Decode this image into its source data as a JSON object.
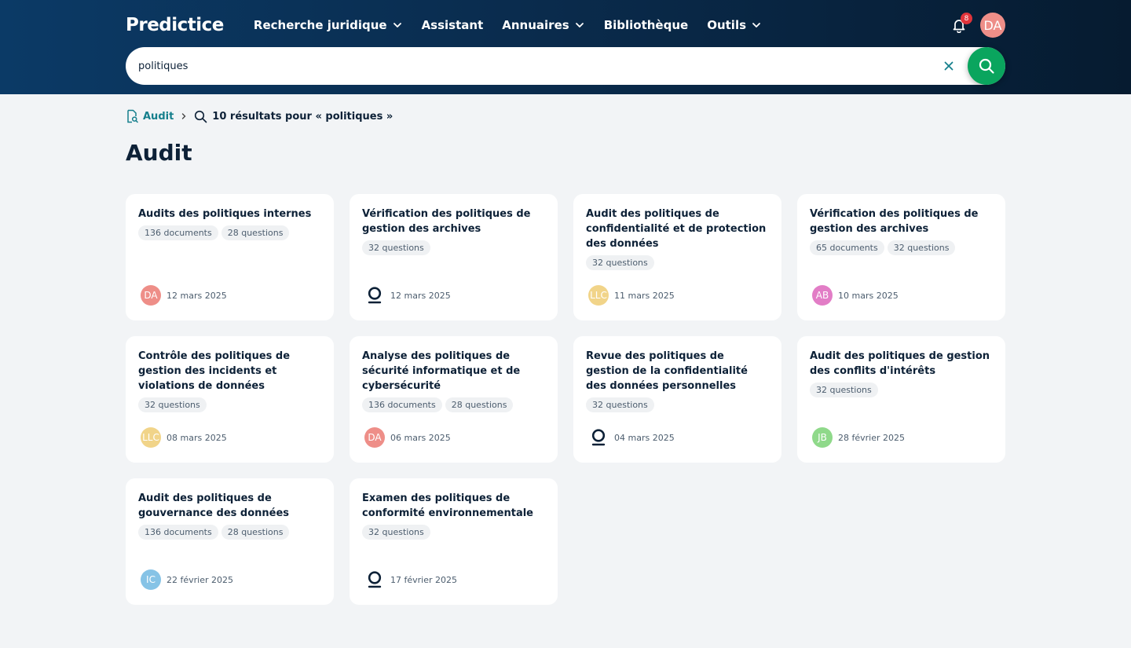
{
  "app": {
    "logo": "Predictice"
  },
  "nav": {
    "items": [
      {
        "label": "Recherche juridique",
        "dropdown": true
      },
      {
        "label": "Assistant",
        "dropdown": false
      },
      {
        "label": "Annuaires",
        "dropdown": true
      },
      {
        "label": "Bibliothèque",
        "dropdown": false
      },
      {
        "label": "Outils",
        "dropdown": true
      }
    ],
    "notifications_count": "8",
    "user_initials": "DA"
  },
  "search": {
    "value": "politiques"
  },
  "breadcrumb": {
    "root": "Audit",
    "current": "10 résultats pour « politiques »"
  },
  "page_title": "Audit",
  "colors": {
    "accent_green": "#0aa55e",
    "link_teal": "#157f8c",
    "badge_red": "#e0343b"
  },
  "cards": [
    {
      "title": "Audits des politiques internes",
      "tags": [
        "136 documents",
        "28 questions"
      ],
      "author": "DA",
      "author_color": "#ee8e88",
      "author_icon": "",
      "date": "12 mars 2025"
    },
    {
      "title": "Vérification des politiques de gestion des archives",
      "tags": [
        "32 questions"
      ],
      "author": "",
      "author_color": "",
      "author_icon": "predictice-logo-icon",
      "date": "12 mars 2025"
    },
    {
      "title": "Audit des politiques de confidentialité et de protection des données",
      "tags": [
        "32 questions"
      ],
      "author": "LLC",
      "author_color": "#f1d489",
      "author_icon": "",
      "date": "11 mars 2025"
    },
    {
      "title": "Vérification des politiques de gestion des archives",
      "tags": [
        "65 documents",
        "32 questions"
      ],
      "author": "AB",
      "author_color": "#e27dc6",
      "author_icon": "",
      "date": "10 mars 2025"
    },
    {
      "title": "Contrôle des politiques de gestion des incidents et violations de données",
      "tags": [
        "32 questions"
      ],
      "author": "LLC",
      "author_color": "#f1d489",
      "author_icon": "",
      "date": "08 mars 2025"
    },
    {
      "title": "Analyse des politiques de sécurité informatique et de cybersécurité",
      "tags": [
        "136 documents",
        "28 questions"
      ],
      "author": "DA",
      "author_color": "#ee8e88",
      "author_icon": "",
      "date": "06 mars 2025"
    },
    {
      "title": "Revue des politiques de gestion de la confidentialité des données personnelles",
      "tags": [
        "32 questions"
      ],
      "author": "",
      "author_color": "",
      "author_icon": "predictice-logo-icon",
      "date": "04 mars 2025"
    },
    {
      "title": "Audit des politiques de gestion des conflits d'intérêts",
      "tags": [
        "32 questions"
      ],
      "author": "JB",
      "author_color": "#8fd98a",
      "author_icon": "",
      "date": "28 février 2025"
    },
    {
      "title": "Audit des politiques de gouvernance des données",
      "tags": [
        "136 documents",
        "28 questions"
      ],
      "author": "IC",
      "author_color": "#86c3e6",
      "author_icon": "",
      "date": "22 février 2025"
    },
    {
      "title": "Examen des politiques de conformité environnementale",
      "tags": [
        "32 questions"
      ],
      "author": "",
      "author_color": "",
      "author_icon": "predictice-logo-icon",
      "date": "17 février 2025"
    }
  ]
}
